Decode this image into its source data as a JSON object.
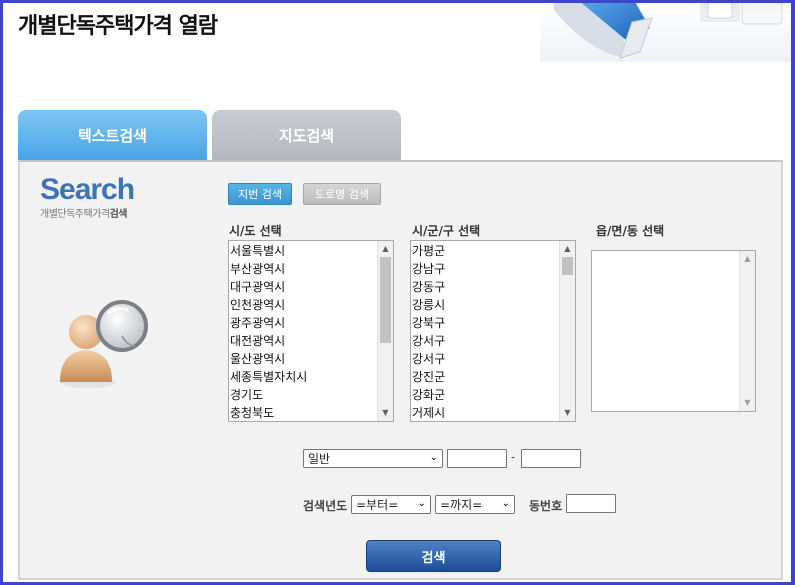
{
  "page": {
    "title": "개별단독주택가격 열람"
  },
  "tabs": [
    {
      "label": "텍스트검색",
      "active": true
    },
    {
      "label": "지도검색",
      "active": false
    }
  ],
  "brand": {
    "word": "Search",
    "sub_plain": "개별단독주택가격",
    "sub_bold": "검색"
  },
  "search_type": {
    "jibun_label": "지번 검색",
    "road_label": "도로명 검색"
  },
  "sido": {
    "label": "시/도 선택",
    "items": [
      "서울특별시",
      "부산광역시",
      "대구광역시",
      "인천광역시",
      "광주광역시",
      "대전광역시",
      "울산광역시",
      "세종특별자치시",
      "경기도",
      "충청북도"
    ]
  },
  "sigungu": {
    "label": "시/군/구 선택",
    "items": [
      "가평군",
      "강남구",
      "강동구",
      "강릉시",
      "강북구",
      "강서구",
      "강서구",
      "강진군",
      "강화군",
      "거제시"
    ]
  },
  "eupmyeondong": {
    "label": "읍/면/동 선택",
    "items": []
  },
  "address": {
    "type_selected": "일반",
    "bonbun": "",
    "bubun": "",
    "dash": "-"
  },
  "year": {
    "label": "검색년도",
    "from_selected": "=부터=",
    "to_selected": "=까지="
  },
  "dong": {
    "label": "동번호",
    "value": ""
  },
  "actions": {
    "search_label": "검색"
  },
  "colors": {
    "frame": "#3f45c8",
    "tab_active": "#4aa3e6",
    "brand": "#3b74b8",
    "search_button": "#1f4d95"
  }
}
